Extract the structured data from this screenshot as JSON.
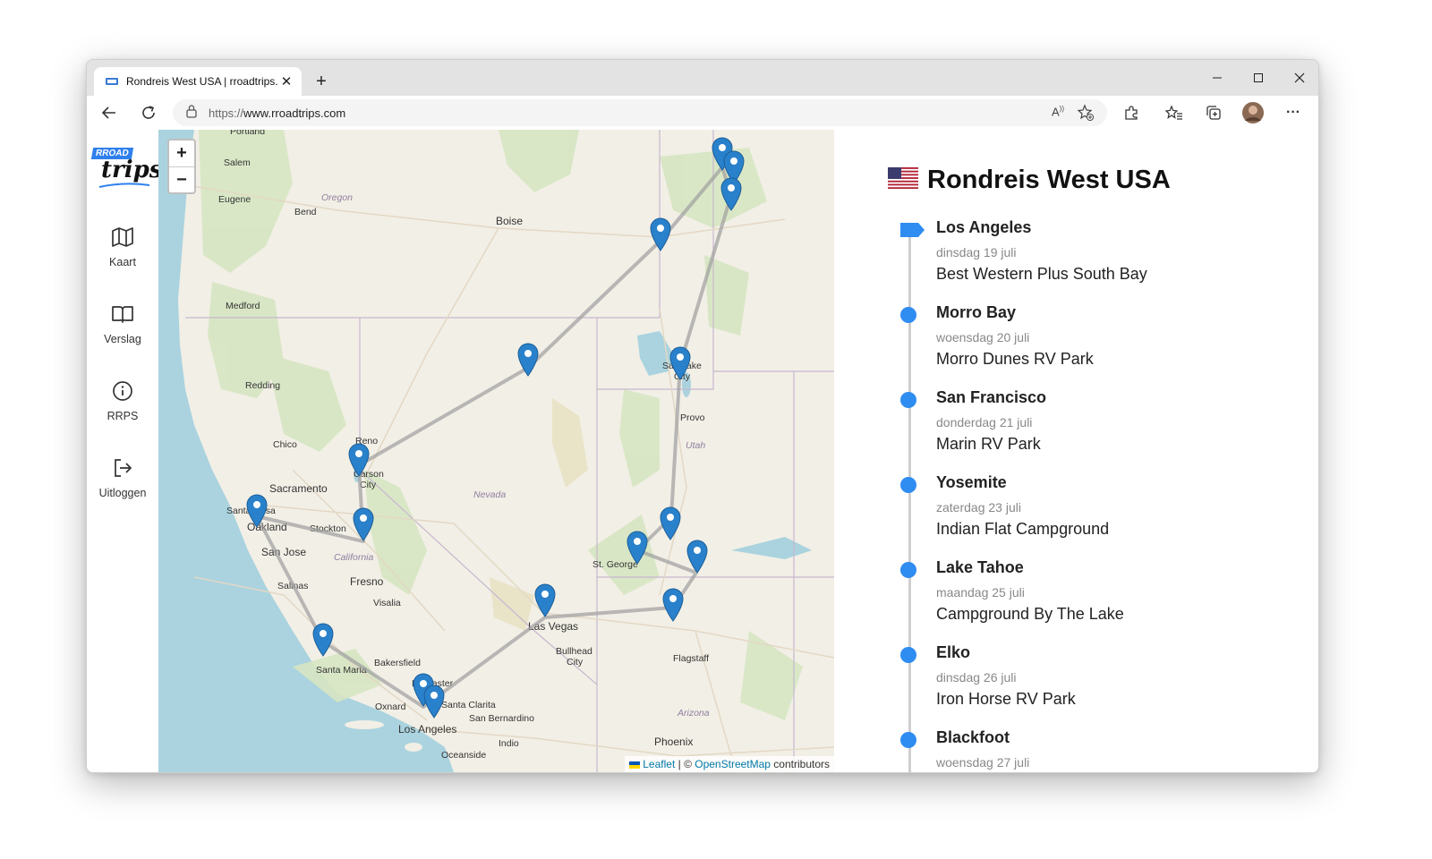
{
  "browser": {
    "tab_title": "Rondreis West USA | rroadtrips.c",
    "url_scheme": "https://",
    "url_host": "www.rroadtrips.com"
  },
  "sidebar": {
    "logo_top": "RROAD",
    "logo_bottom": "trips",
    "items": [
      {
        "label": "Kaart",
        "icon": "map-icon"
      },
      {
        "label": "Verslag",
        "icon": "book-icon"
      },
      {
        "label": "RRPS",
        "icon": "info-icon"
      },
      {
        "label": "Uitloggen",
        "icon": "logout-icon"
      }
    ]
  },
  "map": {
    "zoom_in": "+",
    "zoom_out": "−",
    "attribution": {
      "leaflet": "Leaflet",
      "separator": " | © ",
      "osm": "OpenStreetMap",
      "suffix": " contributors"
    },
    "labels": [
      {
        "text": "Portland"
      },
      {
        "text": "Salem"
      },
      {
        "text": "Eugene"
      },
      {
        "text": "Bend"
      },
      {
        "text": "Oregon"
      },
      {
        "text": "Boise"
      },
      {
        "text": "Medford"
      },
      {
        "text": "Redding"
      },
      {
        "text": "Chico"
      },
      {
        "text": "Reno"
      },
      {
        "text": "Carson"
      },
      {
        "text": "City"
      },
      {
        "text": "Sacramento"
      },
      {
        "text": "Santa Rosa"
      },
      {
        "text": "Oakland"
      },
      {
        "text": "Stockton"
      },
      {
        "text": "San Jose"
      },
      {
        "text": "California"
      },
      {
        "text": "Fresno"
      },
      {
        "text": "Visalia"
      },
      {
        "text": "Salinas"
      },
      {
        "text": "Santa Maria"
      },
      {
        "text": "Bakersfield"
      },
      {
        "text": "Lancaster"
      },
      {
        "text": "Santa Clarita"
      },
      {
        "text": "Oxnard"
      },
      {
        "text": "San Bernardino"
      },
      {
        "text": "Los Angeles"
      },
      {
        "text": "Indio"
      },
      {
        "text": "Oceanside"
      },
      {
        "text": "Nevada"
      },
      {
        "text": "Las Vegas"
      },
      {
        "text": "Bullhead"
      },
      {
        "text": "City"
      },
      {
        "text": "St. George"
      },
      {
        "text": "Flagstaff"
      },
      {
        "text": "Arizona"
      },
      {
        "text": "Phoenix"
      },
      {
        "text": "Salt Lake"
      },
      {
        "text": "City"
      },
      {
        "text": "Provo"
      },
      {
        "text": "Utah"
      }
    ]
  },
  "trip": {
    "title": "Rondreis West USA",
    "flag": "us-flag",
    "accent": "#2f8cf0",
    "stops": [
      {
        "city": "Los Angeles",
        "date": "dinsdag 19 juli",
        "lodging": "Best Western Plus South Bay",
        "start": true
      },
      {
        "city": "Morro Bay",
        "date": "woensdag 20 juli",
        "lodging": "Morro Dunes RV Park"
      },
      {
        "city": "San Francisco",
        "date": "donderdag 21 juli",
        "lodging": "Marin RV Park"
      },
      {
        "city": "Yosemite",
        "date": "zaterdag 23 juli",
        "lodging": "Indian Flat Campground"
      },
      {
        "city": "Lake Tahoe",
        "date": "maandag 25 juli",
        "lodging": "Campground By The Lake"
      },
      {
        "city": "Elko",
        "date": "dinsdag 26 juli",
        "lodging": "Iron Horse RV Park"
      },
      {
        "city": "Blackfoot",
        "date": "woensdag 27 juli",
        "lodging": ""
      }
    ]
  }
}
